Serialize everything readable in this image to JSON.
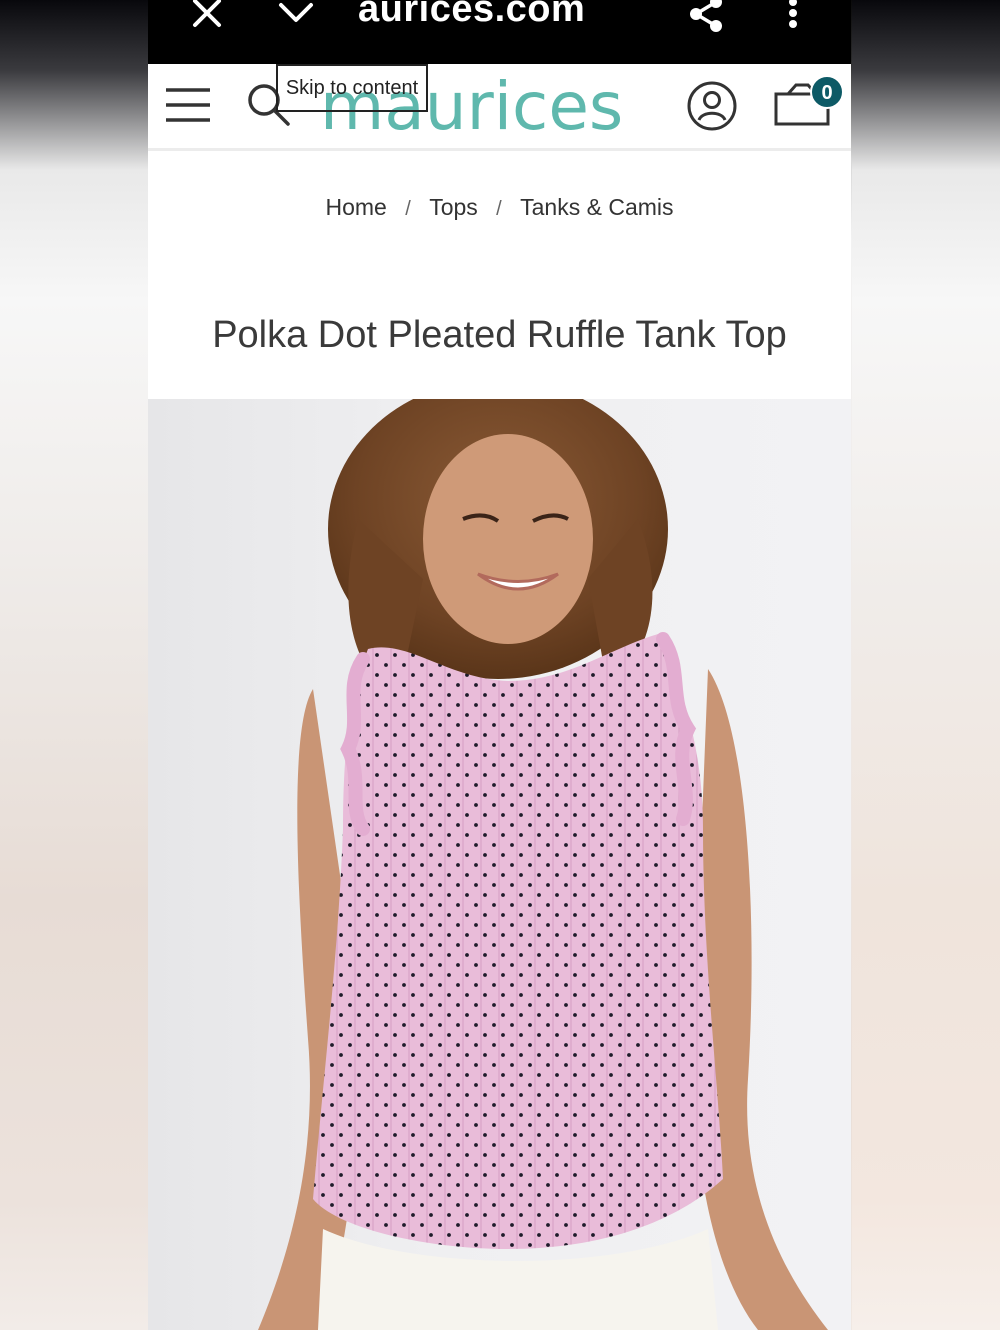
{
  "browser": {
    "url": "aurices.com",
    "icons": [
      "close-icon",
      "chevron-down-icon",
      "share-icon",
      "more-vert-icon"
    ]
  },
  "header": {
    "logo": "maurices",
    "skip_link": "Skip to content",
    "cart_count": "0",
    "icons": [
      "menu-icon",
      "search-icon",
      "account-icon",
      "cart-icon"
    ],
    "brand_color": "#5fb8ad",
    "badge_color": "#0d5a66"
  },
  "breadcrumb": {
    "items": [
      "Home",
      "Tops",
      "Tanks & Camis"
    ],
    "separator": "/"
  },
  "product": {
    "title": "Polka Dot Pleated Ruffle Tank Top",
    "top_color": "#e8b8d8"
  }
}
